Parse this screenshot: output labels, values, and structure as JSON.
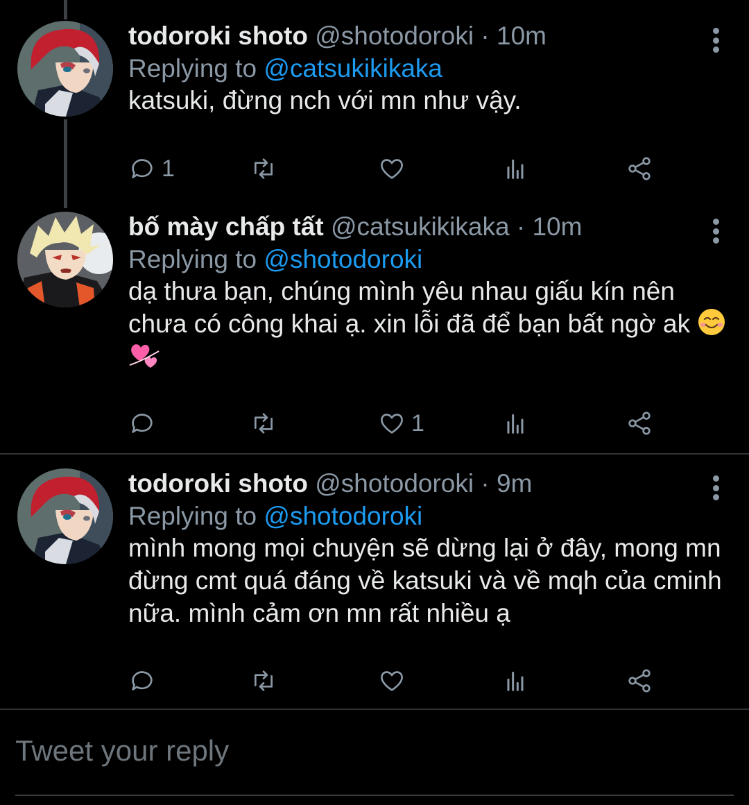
{
  "tweets": [
    {
      "name": "todoroki shoto",
      "handle": "@shotodoroki",
      "time": "· 10m",
      "replying_prefix": "Replying to ",
      "replying_to": "@catsukikikaka",
      "body": "katsuki, đừng nch với mn như vậy.",
      "replies": "1",
      "likes": ""
    },
    {
      "name": "bố mày chấp tất",
      "handle": "@catsukikikaka",
      "time": "· 10m",
      "replying_prefix": "Replying to ",
      "replying_to": "@shotodoroki",
      "body": "dạ thưa bạn, chúng mình yêu nhau giấu kín nên chưa có công khai ạ. xin lỗi đã để bạn bất ngờ ak",
      "replies": "",
      "likes": "1"
    },
    {
      "name": "todoroki shoto",
      "handle": "@shotodoroki",
      "time": "· 9m",
      "replying_prefix": "Replying to ",
      "replying_to": "@shotodoroki",
      "body": "mình mong mọi chuyện sẽ dừng lại ở đây, mong mn đừng cmt quá đáng về katsuki và về mqh của cminh nữa. mình cảm ơn mn rất nhiều ạ",
      "replies": "",
      "likes": ""
    }
  ],
  "compose": {
    "placeholder": "Tweet your reply"
  },
  "icons": {
    "reply": "reply-icon",
    "retweet": "retweet-icon",
    "like": "heart-icon",
    "views": "analytics-icon",
    "share": "share-icon",
    "more": "more-icon"
  },
  "colors": {
    "background": "#000000",
    "text": "#e7e9ea",
    "muted": "#8b98a5",
    "link": "#1d9bf0"
  }
}
